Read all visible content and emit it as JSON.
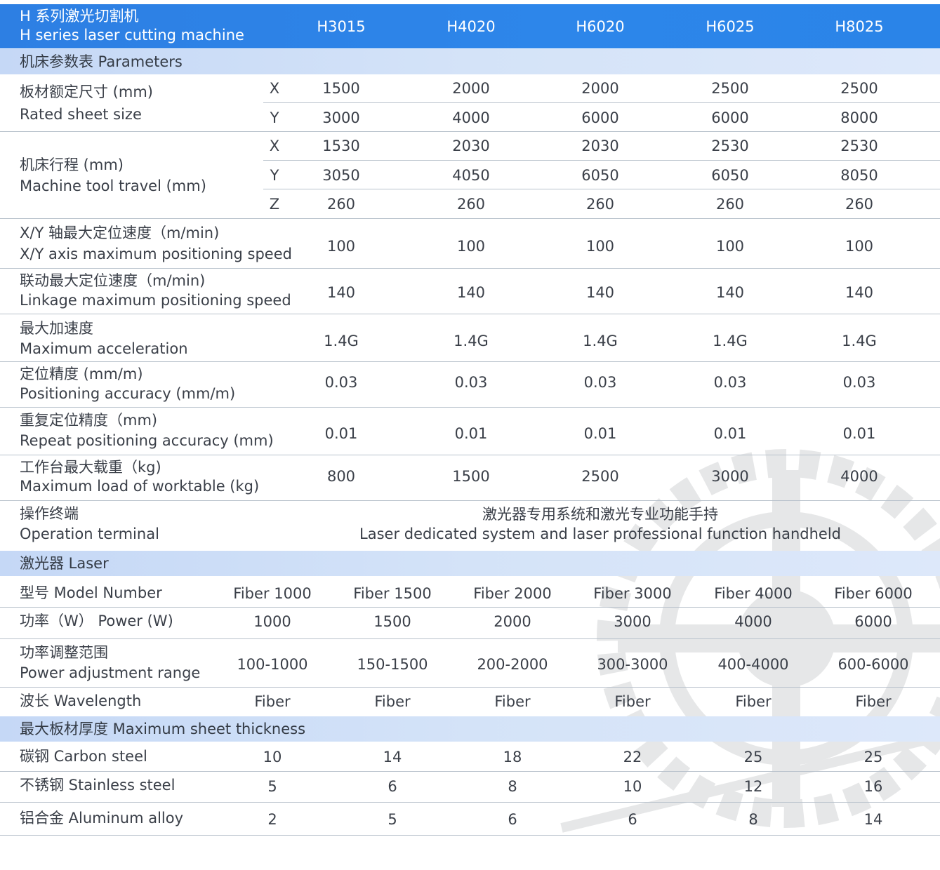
{
  "header": {
    "title_zh": "H 系列激光切割机",
    "title_en": "H series laser cutting machine",
    "models": [
      "H3015",
      "H4020",
      "H6020",
      "H6025",
      "H8025"
    ]
  },
  "sections": {
    "parameters": "机床参数表   Parameters",
    "laser": "激光器  Laser",
    "thickness": "最大板材厚度  Maximum sheet thickness"
  },
  "params": {
    "sheet_size": {
      "zh": "板材额定尺寸 (mm)",
      "en": "Rated sheet size",
      "X": [
        "1500",
        "2000",
        "2000",
        "2500",
        "2500"
      ],
      "Y": [
        "3000",
        "4000",
        "6000",
        "6000",
        "8000"
      ]
    },
    "travel": {
      "zh": "机床行程 (mm)",
      "en": "Machine tool travel (mm)",
      "X": [
        "1530",
        "2030",
        "2030",
        "2530",
        "2530"
      ],
      "Y": [
        "3050",
        "4050",
        "6050",
        "6050",
        "8050"
      ],
      "Z": [
        "260",
        "260",
        "260",
        "260",
        "260"
      ]
    },
    "xy_speed": {
      "zh": "X/Y 轴最大定位速度（m/min)",
      "en": "X/Y axis maximum positioning speed",
      "values": [
        "100",
        "100",
        "100",
        "100",
        "100"
      ]
    },
    "linkage_speed": {
      "zh": "联动最大定位速度（m/min)",
      "en": "Linkage maximum positioning speed",
      "values": [
        "140",
        "140",
        "140",
        "140",
        "140"
      ]
    },
    "acceleration": {
      "zh": "最大加速度",
      "en": "Maximum acceleration",
      "values": [
        "1.4G",
        "1.4G",
        "1.4G",
        "1.4G",
        "1.4G"
      ]
    },
    "accuracy": {
      "zh": "定位精度 (mm/m)",
      "en": "Positioning accuracy (mm/m)",
      "values": [
        "0.03",
        "0.03",
        "0.03",
        "0.03",
        "0.03"
      ]
    },
    "repeat": {
      "zh": "重复定位精度（mm)",
      "en": "Repeat positioning accuracy (mm)",
      "values": [
        "0.01",
        "0.01",
        "0.01",
        "0.01",
        "0.01"
      ]
    },
    "load": {
      "zh": "工作台最大载重（kg)",
      "en": "Maximum load of worktable (kg)",
      "values": [
        "800",
        "1500",
        "2500",
        "3000",
        "4000"
      ]
    },
    "terminal": {
      "zh": "操作终端",
      "en": "Operation terminal",
      "value_zh": "激光器专用系统和激光专业功能手持",
      "value_en": "Laser dedicated system and laser professional function handheld"
    }
  },
  "laser": {
    "model": {
      "label": "型号  Model Number",
      "values": [
        "Fiber 1000",
        "Fiber 1500",
        "Fiber 2000",
        "Fiber 3000",
        "Fiber 4000",
        "Fiber 6000"
      ]
    },
    "power": {
      "label": "功率（W） Power (W)",
      "values": [
        "1000",
        "1500",
        "2000",
        "3000",
        "4000",
        "6000"
      ]
    },
    "range": {
      "zh": "功率调整范围",
      "en": "Power adjustment range",
      "values": [
        "100-1000",
        "150-1500",
        "200-2000",
        "300-3000",
        "400-4000",
        "600-6000"
      ]
    },
    "wavelength": {
      "label": "波长  Wavelength",
      "values": [
        "Fiber",
        "Fiber",
        "Fiber",
        "Fiber",
        "Fiber",
        "Fiber"
      ]
    }
  },
  "thickness": {
    "carbon": {
      "label": "碳钢   Carbon steel",
      "values": [
        "10",
        "14",
        "18",
        "22",
        "25",
        "25"
      ]
    },
    "stainless": {
      "label": "不锈钢  Stainless steel",
      "values": [
        "5",
        "6",
        "8",
        "10",
        "12",
        "16"
      ]
    },
    "aluminum": {
      "label": "铝合金  Aluminum alloy",
      "values": [
        "2",
        "5",
        "6",
        "6",
        "8",
        "14"
      ]
    }
  },
  "colors": {
    "header_blue": "#2d7fe3",
    "section_blue": "#c5d8f6",
    "text": "#3a3f48",
    "rule": "#b9c2cc"
  }
}
